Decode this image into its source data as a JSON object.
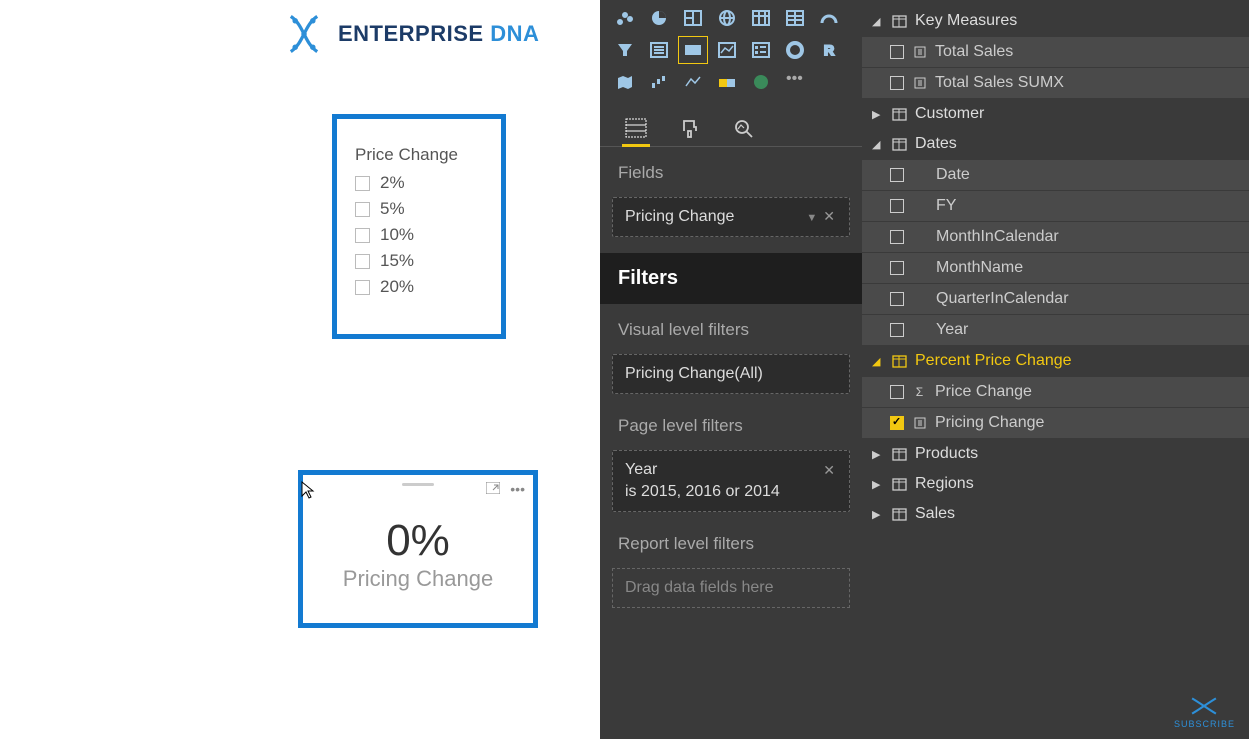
{
  "logo": {
    "text1": "ENTERPRISE ",
    "text2": "DNA"
  },
  "slicer": {
    "title": "Price Change",
    "items": [
      "2%",
      "5%",
      "10%",
      "15%",
      "20%"
    ]
  },
  "card": {
    "value": "0%",
    "label": "Pricing Change"
  },
  "viz_panel": {
    "tabs_active": 0,
    "fields_label": "Fields",
    "field_well": "Pricing Change",
    "filters_head": "Filters",
    "visual_filters_label": "Visual level filters",
    "visual_filter": "Pricing Change(All)",
    "page_filters_label": "Page level filters",
    "page_filter_line1": "Year",
    "page_filter_line2": "is 2015, 2016 or 2014",
    "report_filters_label": "Report level filters",
    "report_filter_placeholder": "Drag data fields here"
  },
  "fields_panel": {
    "tree": {
      "key_measures": {
        "label": "Key Measures",
        "children": [
          "Total Sales",
          "Total Sales SUMX"
        ]
      },
      "customer": {
        "label": "Customer"
      },
      "dates": {
        "label": "Dates",
        "children": [
          "Date",
          "FY",
          "MonthInCalendar",
          "MonthName",
          "QuarterInCalendar",
          "Year"
        ]
      },
      "percent_price_change": {
        "label": "Percent Price Change",
        "children": [
          {
            "label": "Price Change",
            "icon": "sigma",
            "checked": false
          },
          {
            "label": "Pricing Change",
            "icon": "calc",
            "checked": true
          }
        ]
      },
      "products": {
        "label": "Products"
      },
      "regions": {
        "label": "Regions"
      },
      "sales": {
        "label": "Sales"
      }
    }
  },
  "subscribe": "SUBSCRIBE"
}
